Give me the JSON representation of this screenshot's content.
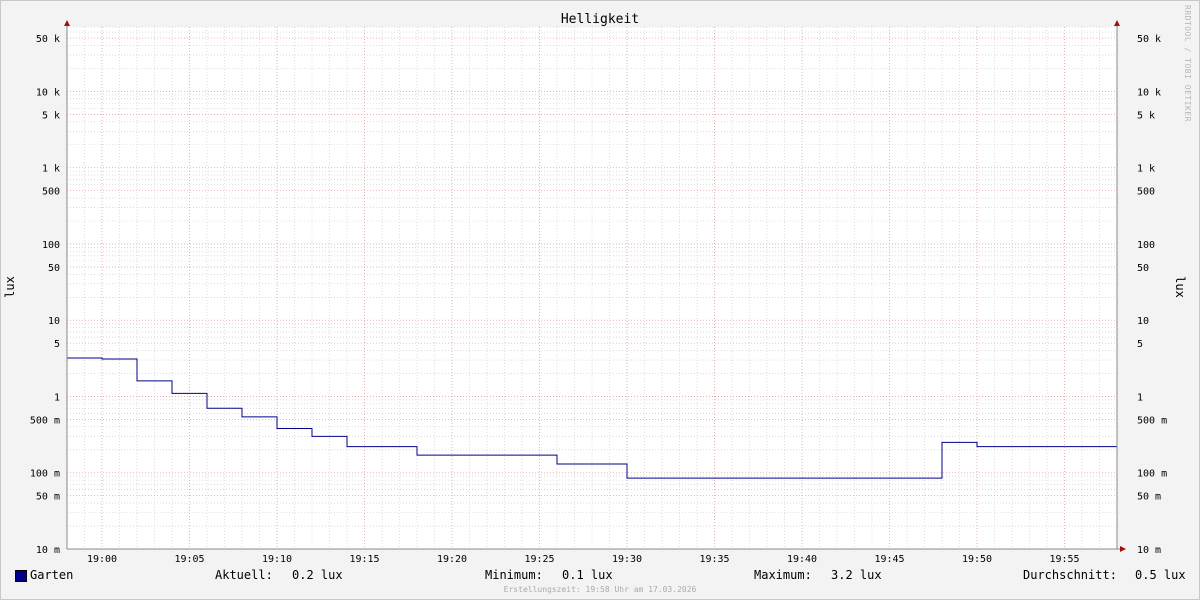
{
  "chart_data": {
    "type": "line",
    "title": "Helligkeit",
    "ylabel_left": "lux",
    "ylabel_right": "lux",
    "y_scale": "log",
    "ylim": [
      0.01,
      70000
    ],
    "xlim": [
      "18:58",
      "19:58"
    ],
    "x_ticks": [
      "19:00",
      "19:05",
      "19:10",
      "19:15",
      "19:20",
      "19:25",
      "19:30",
      "19:35",
      "19:40",
      "19:45",
      "19:50",
      "19:55"
    ],
    "y_ticks": [
      {
        "value": 50000,
        "label": "50 k"
      },
      {
        "value": 10000,
        "label": "10 k"
      },
      {
        "value": 5000,
        "label": "5 k"
      },
      {
        "value": 1000,
        "label": "1 k"
      },
      {
        "value": 500,
        "label": "500"
      },
      {
        "value": 100,
        "label": "100"
      },
      {
        "value": 50,
        "label": "50"
      },
      {
        "value": 10,
        "label": "10"
      },
      {
        "value": 5,
        "label": "5"
      },
      {
        "value": 1,
        "label": "1"
      },
      {
        "value": 0.5,
        "label": "500 m"
      },
      {
        "value": 0.1,
        "label": "100 m"
      },
      {
        "value": 0.05,
        "label": "50 m"
      },
      {
        "value": 0.01,
        "label": "10 m"
      }
    ],
    "grid": true,
    "series": [
      {
        "name": "Garten",
        "color": "#00008b",
        "step": true,
        "x": [
          "18:58",
          "19:00",
          "19:02",
          "19:04",
          "19:06",
          "19:08",
          "19:10",
          "19:12",
          "19:14",
          "19:18",
          "19:26",
          "19:30",
          "19:48",
          "19:50",
          "19:58"
        ],
        "y": [
          3.2,
          3.1,
          1.6,
          1.1,
          0.7,
          0.54,
          0.38,
          0.3,
          0.22,
          0.17,
          0.13,
          0.085,
          0.25,
          0.22,
          0.22
        ]
      }
    ]
  },
  "legend": {
    "series_label": "Garten",
    "aktuell_label": "Aktuell:",
    "aktuell_value": "0.2 lux",
    "minimum_label": "Minimum:",
    "minimum_value": "0.1 lux",
    "maximum_label": "Maximum:",
    "maximum_value": "3.2 lux",
    "durchschnitt_label": "Durchschnitt:",
    "durchschnitt_value": "0.5 lux"
  },
  "footer": "Erstellungszeit: 19:58 Uhr am 17.03.2026",
  "watermark": "RRDTOOL / TOBI OETIKER",
  "colors": {
    "line": "#00008b",
    "major_grid": "#e8a0a0",
    "minor_grid": "#c8c8c8",
    "background": "#ffffff",
    "canvas": "#f3f3f3"
  }
}
